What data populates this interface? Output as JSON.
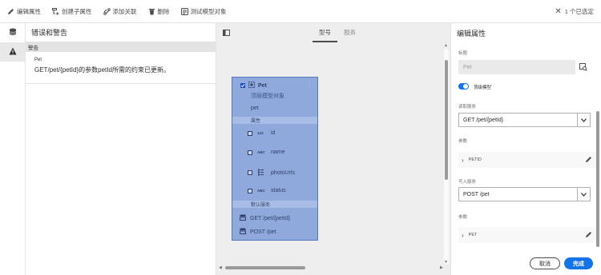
{
  "toolbar": {
    "items": [
      {
        "label": "编辑属性",
        "icon": "pencil-icon"
      },
      {
        "label": "创建子属性",
        "icon": "create-child-icon"
      },
      {
        "label": "添加关联",
        "icon": "link-icon"
      },
      {
        "label": "删除",
        "icon": "trash-icon"
      },
      {
        "label": "测试模型对象",
        "icon": "test-icon"
      }
    ],
    "selection": "1 个已选定"
  },
  "left_panel": {
    "title": "错误和警告",
    "section": "警告",
    "warning": {
      "name": "Pet",
      "message": "GET/pet/{petId}的参数petId所需的约束已更新。"
    }
  },
  "canvas": {
    "tabs": [
      "型号",
      "服务"
    ],
    "active_tab": "型号",
    "node": {
      "title": "Pet",
      "subtitle": "顶层模型对象",
      "model_name": "pet",
      "properties_label": "属性",
      "properties": [
        {
          "type": "123",
          "name": "id"
        },
        {
          "type": "ABC",
          "name": "name"
        },
        {
          "type": "",
          "name": "photoUrls"
        },
        {
          "type": "ABC",
          "name": "status"
        }
      ],
      "services_label": "默认服务",
      "services": [
        "GET /pet/{petId}",
        "POST /pet"
      ]
    }
  },
  "right_panel": {
    "title": "编辑属性",
    "title_label": "标题",
    "title_placeholder": "Pet",
    "top_level_label": "顶级模型",
    "read_service_label": "读取服务",
    "read_service_value": "GET /pet/{petId}",
    "params_label_1": "参数",
    "param_1": "PETID",
    "write_service_label": "写入服务",
    "write_service_value": "POST /pet",
    "params_label_2": "参数",
    "param_2": "PET",
    "cancel": "取消",
    "done": "完成"
  },
  "colors": {
    "accent": "#1473e6",
    "node_fill": "#8fa9dc",
    "node_border": "#5577c0"
  }
}
